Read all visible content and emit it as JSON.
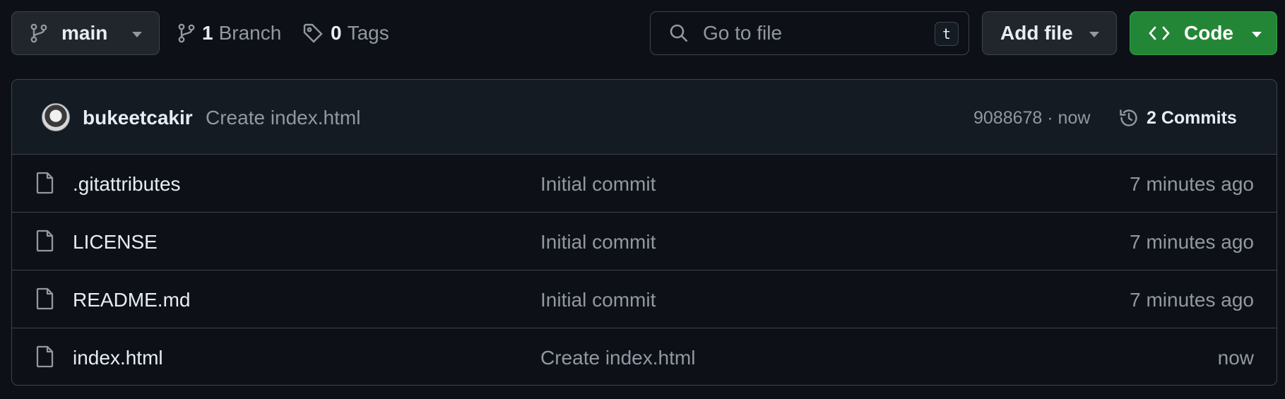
{
  "colors": {
    "background": "#0d1117",
    "code_button": "#238636",
    "muted_text": "#9198a1",
    "border": "#3d444d"
  },
  "toolbar": {
    "branch": {
      "label": "main",
      "icon": "git-branch-icon"
    },
    "branches": {
      "count": "1",
      "label": "Branch",
      "icon": "git-branch-icon"
    },
    "tags": {
      "count": "0",
      "label": "Tags",
      "icon": "tag-icon"
    },
    "search": {
      "placeholder": "Go to file",
      "shortcut": "t",
      "icon": "search-icon"
    },
    "add_file": {
      "label": "Add file"
    },
    "code": {
      "label": "Code",
      "icon": "code-icon"
    }
  },
  "latest_commit": {
    "author": "bukeetcakir",
    "message": "Create index.html",
    "meta": "9088678 · now",
    "commits_label": "2 Commits",
    "commits_icon": "history-icon"
  },
  "files": [
    {
      "name": ".gitattributes",
      "commit": "Initial commit",
      "age": "7 minutes ago"
    },
    {
      "name": "LICENSE",
      "commit": "Initial commit",
      "age": "7 minutes ago"
    },
    {
      "name": "README.md",
      "commit": "Initial commit",
      "age": "7 minutes ago"
    },
    {
      "name": "index.html",
      "commit": "Create index.html",
      "age": "now"
    }
  ]
}
